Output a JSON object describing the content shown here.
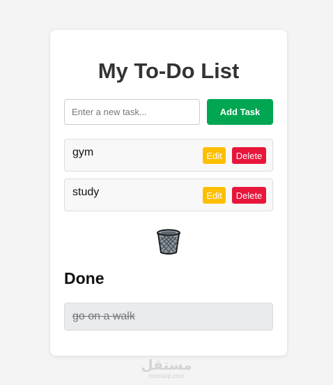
{
  "header": {
    "title": "My To-Do List"
  },
  "new_task": {
    "placeholder": "Enter a new task...",
    "value": "",
    "add_label": "Add Task"
  },
  "tasks": [
    {
      "text": "gym",
      "edit_label": "Edit",
      "delete_label": "Delete"
    },
    {
      "text": "study",
      "edit_label": "Edit",
      "delete_label": "Delete"
    }
  ],
  "trash": {
    "icon": "trash-can-icon"
  },
  "done": {
    "heading": "Done",
    "items": [
      {
        "text": "go on a walk"
      }
    ]
  },
  "watermark": {
    "logo": "مستقل",
    "site": "mostaql.com"
  },
  "colors": {
    "add_button": "#00a651",
    "edit_button": "#ffbf00",
    "delete_button": "#e8163a",
    "done_item_bg": "#e9ebee"
  }
}
